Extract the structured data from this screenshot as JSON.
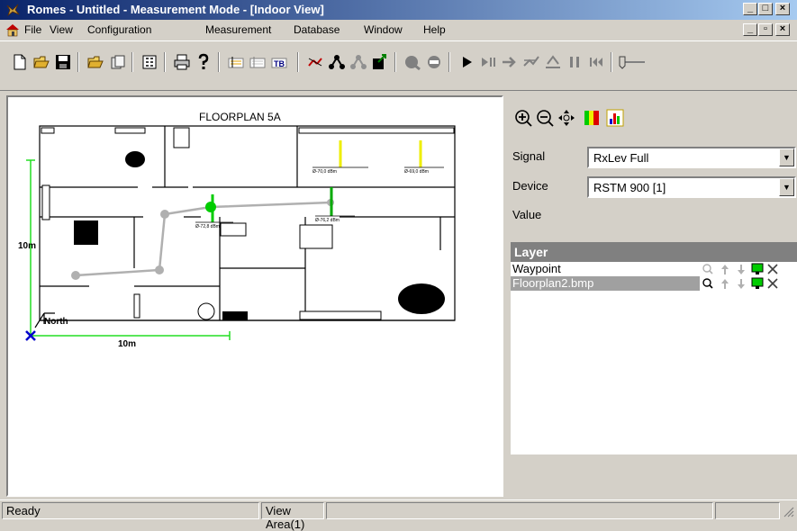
{
  "window": {
    "title": "Romes - Untitled - Measurement Mode - [Indoor View]",
    "app_icon": "romes-logo-icon",
    "controls": {
      "minimize": "_",
      "restore": "□",
      "close": "×"
    }
  },
  "menubar": {
    "icon": "home-icon",
    "items": [
      "File",
      "View",
      "Configuration",
      "Measurement",
      "Database",
      "Window",
      "Help"
    ],
    "mdi_controls": {
      "minimize": "_",
      "restore": "▫",
      "close": "×"
    }
  },
  "toolbar": {
    "icons": [
      "new-icon",
      "open-folder-icon",
      "save-icon",
      "open-workspace-icon",
      "close-workspace-icon",
      "configuration-icon",
      "print-icon",
      "help-icon",
      "text-view-a-icon",
      "text-view-b-icon",
      "text-view-c-icon",
      "signal-icon",
      "route-icon",
      "route-gray-icon",
      "export-icon",
      "stop-gray-icon",
      "record-stop-icon",
      "play-icon",
      "pause-icon",
      "step-icon",
      "route-step-icon",
      "filter-icon",
      "pause-bars-icon",
      "rewind-icon",
      "slider-icon"
    ]
  },
  "view": {
    "floorplan_title": "FLOORPLAN 5A",
    "dimension_vertical": "10m",
    "dimension_horizontal": "10m",
    "north_label": "North",
    "measurements": [
      "Ø-70,0 dBm",
      "Ø-69,0 dBm",
      "Ø-72,8 dBm",
      "Ø-76,2 dBm"
    ],
    "colors": {
      "route": "#b0b0b0",
      "dimension": "#22dd22",
      "strong_signal": "#00cc00",
      "weak_signal": "#eeee00",
      "origin": "#0000cc"
    }
  },
  "sidepanel": {
    "zoom_icons": [
      "zoom-in-icon",
      "zoom-out-icon",
      "pan-icon",
      "color-scale-icon",
      "histogram-icon"
    ],
    "signal_label": "Signal",
    "signal_value": "RxLev Full",
    "device_label": "Device",
    "device_value": "RSTM 900 [1]",
    "value_label": "Value",
    "layer_header": "Layer",
    "layers": [
      {
        "name": "Waypoint",
        "selected": false
      },
      {
        "name": "Floorplan2.bmp",
        "selected": true
      }
    ]
  },
  "statusbar": {
    "status": "Ready",
    "view_area": "View Area(1)"
  }
}
